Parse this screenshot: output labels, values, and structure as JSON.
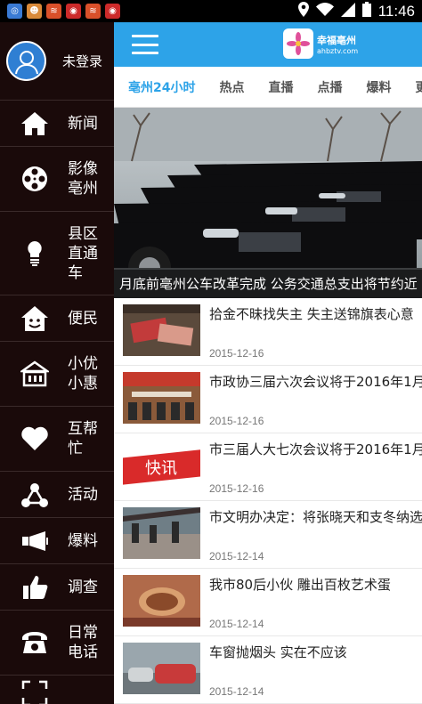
{
  "status_bar": {
    "time": "11:46",
    "notification_icons": [
      "app-icon-1",
      "app-icon-2",
      "app-icon-3",
      "app-icon-4",
      "app-icon-5",
      "app-icon-6"
    ]
  },
  "sidebar": {
    "profile_label": "未登录",
    "items": [
      {
        "label": "新闻",
        "icon": "home-icon"
      },
      {
        "label": "影像\n亳州",
        "icon": "film-reel-icon"
      },
      {
        "label": "县区\n直通\n车",
        "icon": "bulb-icon"
      },
      {
        "label": "便民",
        "icon": "smile-house-icon"
      },
      {
        "label": "小优\n小惠",
        "icon": "basket-icon"
      },
      {
        "label": "互帮\n忙",
        "icon": "heart-icon"
      },
      {
        "label": "活动",
        "icon": "share-nodes-icon"
      },
      {
        "label": "爆料",
        "icon": "megaphone-icon"
      },
      {
        "label": "调查",
        "icon": "thumbs-up-icon"
      },
      {
        "label": "日常\n电话",
        "icon": "phone-icon"
      }
    ]
  },
  "header": {
    "logo_name": "幸福亳州",
    "logo_url": "ahbztv.com"
  },
  "tabs": [
    "亳州24小时",
    "热点",
    "直播",
    "点播",
    "爆料",
    "更"
  ],
  "hero": {
    "caption": "月底前亳州公车改革完成 公务交通总支出将节约近"
  },
  "news": [
    {
      "title": "拾金不昧找失主 失主送锦旗表心意",
      "date": "2015-12-16"
    },
    {
      "title": "市政协三届六次会议将于2016年1月",
      "date": "2015-12-16"
    },
    {
      "title": "市三届人大七次会议将于2016年1月",
      "date": "2015-12-16"
    },
    {
      "title": "市文明办决定：将张晓天和支冬纳选",
      "date": "2015-12-14"
    },
    {
      "title": "我市80后小伙 雕出百枚艺术蛋",
      "date": "2015-12-14"
    },
    {
      "title": "车窗抛烟头 实在不应该",
      "date": "2015-12-14"
    }
  ],
  "thumb_stamp": "快讯",
  "colors": {
    "accent": "#2da3e8",
    "sidebar_bg": "#1a0a0a"
  }
}
